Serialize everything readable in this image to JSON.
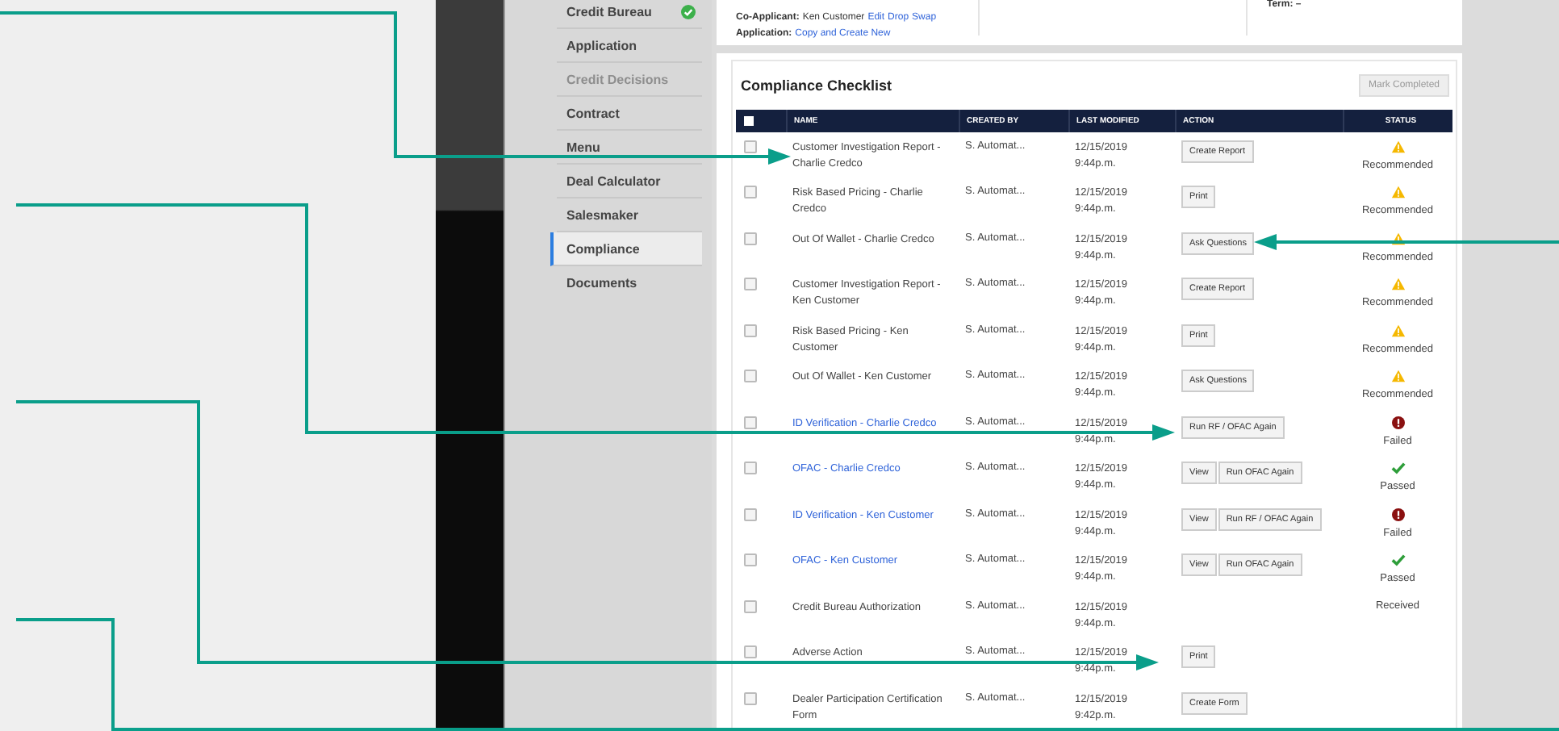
{
  "sidebar": {
    "items": [
      {
        "label": "Credit Bureau",
        "selected": false,
        "disabled": false,
        "complete": true
      },
      {
        "label": "Application",
        "selected": false,
        "disabled": false,
        "complete": false
      },
      {
        "label": "Credit Decisions",
        "selected": false,
        "disabled": true,
        "complete": false
      },
      {
        "label": "Contract",
        "selected": false,
        "disabled": false,
        "complete": false
      },
      {
        "label": "Menu",
        "selected": false,
        "disabled": false,
        "complete": false
      },
      {
        "label": "Deal Calculator",
        "selected": false,
        "disabled": false,
        "complete": false
      },
      {
        "label": "Salesmaker",
        "selected": false,
        "disabled": false,
        "complete": false
      },
      {
        "label": "Compliance",
        "selected": true,
        "disabled": false,
        "complete": false
      },
      {
        "label": "Documents",
        "selected": false,
        "disabled": false,
        "complete": false
      }
    ]
  },
  "deal_info": {
    "co_applicant_label": "Co-Applicant:",
    "co_applicant": "Ken Customer",
    "co_applicant_links": [
      "Edit",
      "Drop",
      "Swap"
    ],
    "application_label": "Application:",
    "application_link": "Copy and Create New",
    "term": "Term: –"
  },
  "checklist": {
    "title": "Compliance Checklist",
    "mark_completed": "Mark Completed",
    "select_all_checked": false,
    "columns": [
      "NAME",
      "CREATED BY",
      "LAST MODIFIED",
      "ACTION",
      "STATUS"
    ],
    "rows": [
      {
        "name": "Customer Investigation Report - Charlie Credco",
        "link": false,
        "checked": false,
        "created_by": "S. Automat...",
        "date": "12/15/2019",
        "time": "9:44p.m.",
        "actions": [
          "Create Report"
        ],
        "kind": "warning",
        "status": "Recommended"
      },
      {
        "name": "Risk Based Pricing - Charlie Credco",
        "link": false,
        "checked": false,
        "created_by": "S. Automat...",
        "date": "12/15/2019",
        "time": "9:44p.m.",
        "actions": [
          "Print"
        ],
        "kind": "warning",
        "status": "Recommended"
      },
      {
        "name": "Out Of Wallet - Charlie Credco",
        "link": false,
        "checked": false,
        "created_by": "S. Automat...",
        "date": "12/15/2019",
        "time": "9:44p.m.",
        "actions": [
          "Ask Questions"
        ],
        "kind": "warning",
        "status": "Recommended"
      },
      {
        "name": "Customer Investigation Report - Ken Customer",
        "link": false,
        "checked": false,
        "created_by": "S. Automat...",
        "date": "12/15/2019",
        "time": "9:44p.m.",
        "actions": [
          "Create Report"
        ],
        "kind": "warning",
        "status": "Recommended"
      },
      {
        "name": "Risk Based Pricing - Ken Customer",
        "link": false,
        "checked": false,
        "created_by": "S. Automat...",
        "date": "12/15/2019",
        "time": "9:44p.m.",
        "actions": [
          "Print"
        ],
        "kind": "warning",
        "status": "Recommended"
      },
      {
        "name": "Out Of Wallet - Ken Customer",
        "link": false,
        "checked": false,
        "created_by": "S. Automat...",
        "date": "12/15/2019",
        "time": "9:44p.m.",
        "actions": [
          "Ask Questions"
        ],
        "kind": "warning",
        "status": "Recommended"
      },
      {
        "name": "ID Verification - Charlie Credco",
        "link": true,
        "checked": false,
        "created_by": "S. Automat...",
        "date": "12/15/2019",
        "time": "9:44p.m.",
        "actions": [
          "Run RF / OFAC Again"
        ],
        "kind": "failed",
        "status": "Failed"
      },
      {
        "name": "OFAC - Charlie Credco",
        "link": true,
        "checked": false,
        "created_by": "S. Automat...",
        "date": "12/15/2019",
        "time": "9:44p.m.",
        "actions": [
          "View",
          "Run OFAC Again"
        ],
        "kind": "passed",
        "status": "Passed"
      },
      {
        "name": "ID Verification - Ken Customer",
        "link": true,
        "checked": false,
        "created_by": "S. Automat...",
        "date": "12/15/2019",
        "time": "9:44p.m.",
        "actions": [
          "View",
          "Run RF / OFAC Again"
        ],
        "kind": "failed",
        "status": "Failed"
      },
      {
        "name": "OFAC - Ken Customer",
        "link": true,
        "checked": false,
        "created_by": "S. Automat...",
        "date": "12/15/2019",
        "time": "9:44p.m.",
        "actions": [
          "View",
          "Run OFAC Again"
        ],
        "kind": "passed",
        "status": "Passed"
      },
      {
        "name": "Credit Bureau Authorization",
        "link": false,
        "checked": false,
        "created_by": "S. Automat...",
        "date": "12/15/2019",
        "time": "9:44p.m.",
        "actions": [],
        "kind": "none",
        "status": "Received"
      },
      {
        "name": "Adverse Action",
        "link": false,
        "checked": false,
        "created_by": "S. Automat...",
        "date": "12/15/2019",
        "time": "9:44p.m.",
        "actions": [
          "Print"
        ],
        "kind": "none"
      },
      {
        "name": "Dealer Participation Certification Form",
        "link": false,
        "checked": false,
        "created_by": "S. Automat...",
        "date": "12/15/2019",
        "time": "9:42p.m.",
        "actions": [
          "Create Form"
        ],
        "kind": "none"
      }
    ]
  }
}
